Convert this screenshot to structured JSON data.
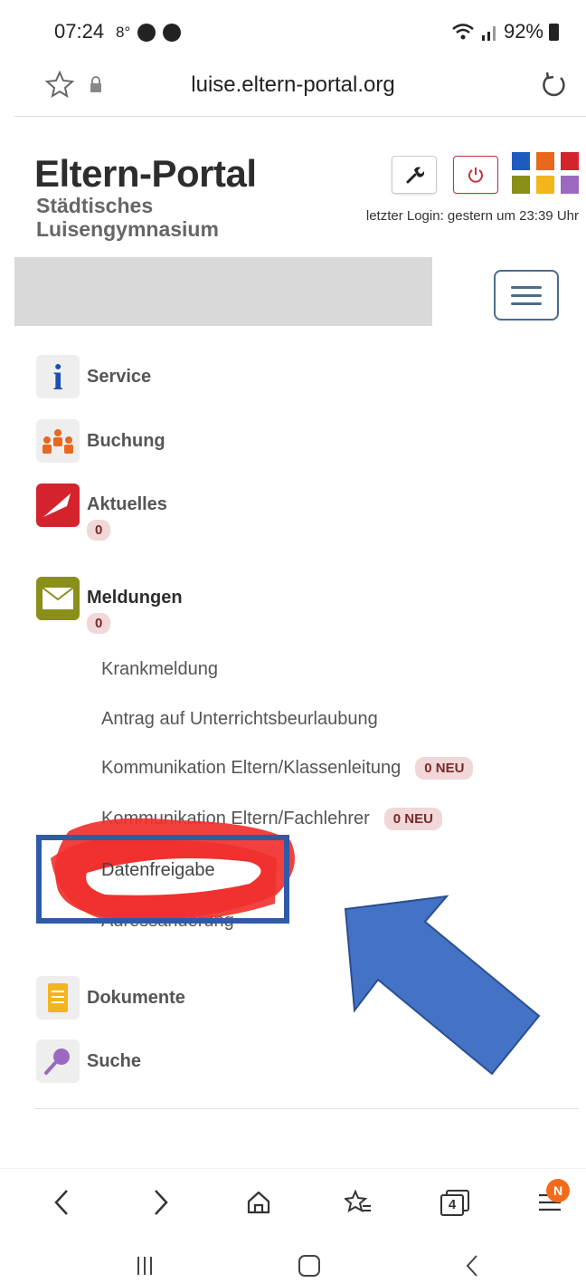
{
  "status": {
    "time": "07:24",
    "temp": "8°",
    "battery": "92%"
  },
  "browser": {
    "url": "luise.eltern-portal.org"
  },
  "header": {
    "title": "Eltern-Portal",
    "school_line1": "Städtisches",
    "school_line2": "Luisengymnasium",
    "last_login": "letzter Login: gestern um 23:39 Uhr",
    "logo_colors": [
      "#1f5bbf",
      "#e8691e",
      "#d5232d",
      "#8a8f1a",
      "#f3b51c",
      "#9b6ac0"
    ]
  },
  "nav": {
    "service": {
      "label": "Service"
    },
    "buchung": {
      "label": "Buchung"
    },
    "aktuelles": {
      "label": "Aktuelles",
      "count": "0"
    },
    "meldungen": {
      "label": "Meldungen",
      "count": "0",
      "sub": {
        "krankmeldung": "Krankmeldung",
        "beurlaubung": "Antrag auf Unterrichtsbeurlaubung",
        "klassenleitung": {
          "label": "Kommunikation Eltern/Klassenleitung",
          "badge": "0 NEU"
        },
        "fachlehrer": {
          "label": "Kommunikation Eltern/Fachlehrer",
          "badge": "0 NEU"
        },
        "datenfreigabe": "Datenfreigabe",
        "adresse": "Adressänderung"
      }
    },
    "dokumente": {
      "label": "Dokumente"
    },
    "suche": {
      "label": "Suche"
    }
  },
  "bottom_bar": {
    "tabs_count": "4",
    "notification": "N"
  },
  "colors": {
    "highlight_box": "#2f5aa8",
    "arrow": "#4472c4",
    "scribble": "#f0302e"
  }
}
